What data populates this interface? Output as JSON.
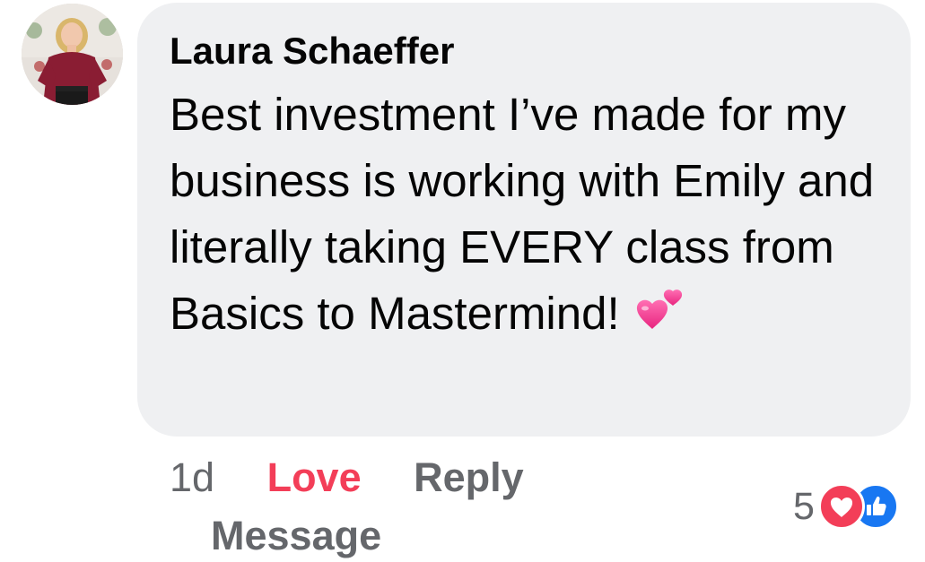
{
  "comment": {
    "author": "Laura Schaeffer",
    "text": "Best investment I’ve made for my business is working with Emily and literally taking EVERY class from Basics to Mastermind!",
    "emoji_icon": "two-hearts-icon"
  },
  "actions": {
    "time": "1d",
    "love_label": "Love",
    "reply_label": "Reply",
    "message_label": "Message"
  },
  "reactions": {
    "count": "5",
    "icons": [
      "love-reaction-icon",
      "like-reaction-icon"
    ]
  },
  "colors": {
    "bubble_bg": "#eff0f2",
    "love_red": "#f33e58",
    "like_blue": "#1877f2",
    "secondary_text": "#65676b",
    "primary_text": "#050505"
  }
}
